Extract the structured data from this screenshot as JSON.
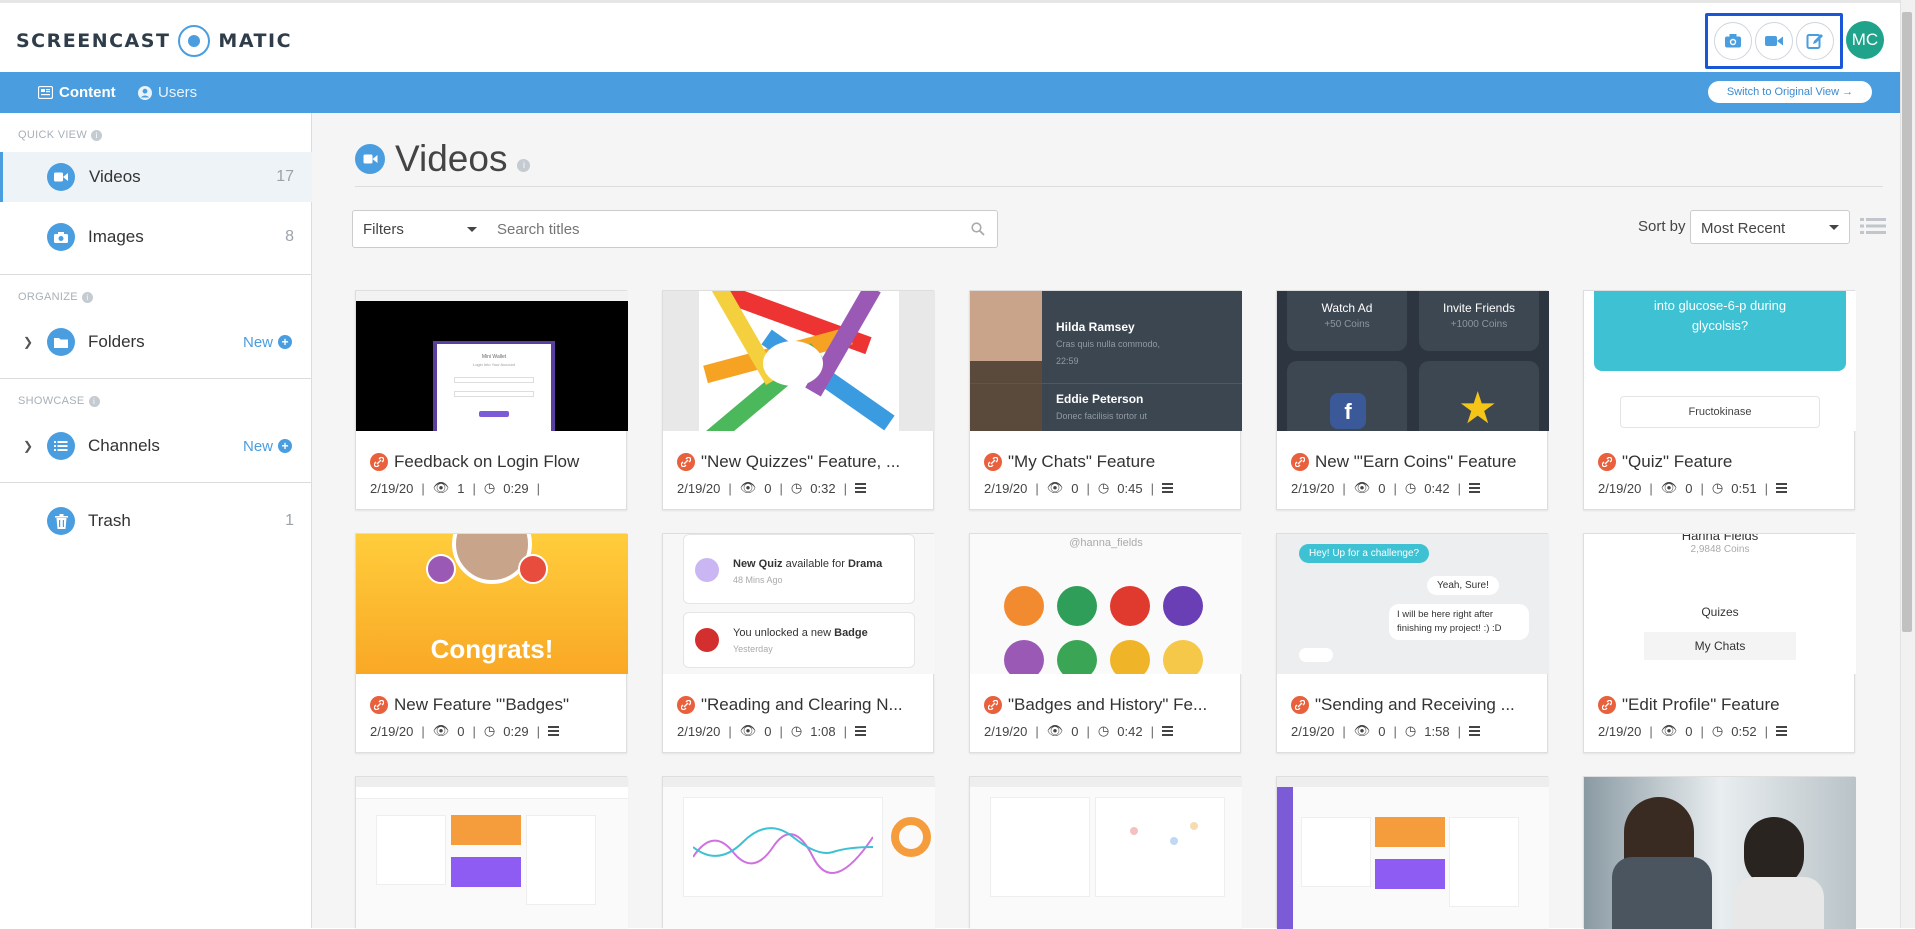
{
  "header": {
    "logo_left": "SCREENCAST",
    "logo_right": "MATIC",
    "avatar_initials": "MC",
    "record_buttons": [
      "camera-icon",
      "video-camera-icon",
      "edit-icon"
    ]
  },
  "nav": {
    "tabs": [
      {
        "label": "Content",
        "icon": "content-icon",
        "active": true
      },
      {
        "label": "Users",
        "icon": "user-icon",
        "active": false
      }
    ],
    "switch_label": "Switch to Original View →"
  },
  "sidebar": {
    "quick_view_label": "QUICK VIEW",
    "organize_label": "ORGANIZE",
    "showcase_label": "SHOWCASE",
    "videos": {
      "label": "Videos",
      "count": "17"
    },
    "images": {
      "label": "Images",
      "count": "8"
    },
    "folders": {
      "label": "Folders",
      "new_label": "New"
    },
    "channels": {
      "label": "Channels",
      "new_label": "New"
    },
    "trash": {
      "label": "Trash",
      "count": "1"
    }
  },
  "main": {
    "title": "Videos",
    "filters_label": "Filters",
    "search_placeholder": "Search titles",
    "sort_label": "Sort by",
    "sort_value": "Most Recent"
  },
  "videos": [
    {
      "title": "Feedback on Login Flow",
      "date": "2/19/20",
      "views": "1",
      "duration": "0:29",
      "thumb": "login"
    },
    {
      "title": "\"New Quizzes\" Feature, ...",
      "date": "2/19/20",
      "views": "0",
      "duration": "0:32",
      "thumb": "pencils"
    },
    {
      "title": "\"My Chats\" Feature",
      "date": "2/19/20",
      "views": "0",
      "duration": "0:45",
      "thumb": "chats"
    },
    {
      "title": "New \"'Earn Coins\" Feature",
      "date": "2/19/20",
      "views": "0",
      "duration": "0:42",
      "thumb": "coins"
    },
    {
      "title": "\"Quiz\" Feature",
      "date": "2/19/20",
      "views": "0",
      "duration": "0:51",
      "thumb": "quiz"
    },
    {
      "title": "New Feature \"'Badges\"",
      "date": "2/19/20",
      "views": "0",
      "duration": "0:29",
      "thumb": "congrats"
    },
    {
      "title": "\"Reading and Clearing N...",
      "date": "2/19/20",
      "views": "0",
      "duration": "1:08",
      "thumb": "notifications"
    },
    {
      "title": "\"Badges and History\" Fe...",
      "date": "2/19/20",
      "views": "0",
      "duration": "0:42",
      "thumb": "badges"
    },
    {
      "title": "\"Sending and Receiving ...",
      "date": "2/19/20",
      "views": "0",
      "duration": "1:58",
      "thumb": "messages"
    },
    {
      "title": "\"Edit Profile\" Feature",
      "date": "2/19/20",
      "views": "0",
      "duration": "0:52",
      "thumb": "profile"
    },
    {
      "title": "",
      "date": "",
      "views": "",
      "duration": "",
      "thumb": "dash1"
    },
    {
      "title": "",
      "date": "",
      "views": "",
      "duration": "",
      "thumb": "dash2"
    },
    {
      "title": "",
      "date": "",
      "views": "",
      "duration": "",
      "thumb": "dash3"
    },
    {
      "title": "",
      "date": "",
      "views": "",
      "duration": "",
      "thumb": "dash4"
    },
    {
      "title": "",
      "date": "",
      "views": "",
      "duration": "",
      "thumb": "office"
    }
  ],
  "thumb_text": {
    "login": {
      "heading": "Mini Wallet",
      "sub": "Login Into Your Account"
    },
    "chats": {
      "name1": "Hilda Ramsey",
      "msg1": "Cras quis nulla commodo,",
      "time1": "22:59",
      "name2": "Eddie Peterson",
      "msg2": "Donec facilisis tortor ut"
    },
    "coins": {
      "t1": "Watch Ad",
      "s1": "+50 Coins",
      "t2": "Invite Friends",
      "s2": "+1000 Coins"
    },
    "quiz": {
      "question": "into glucose-6-p during glycolsis?",
      "answer": "Fructokinase"
    },
    "congrats": {
      "text": "Congrats!"
    },
    "notifications": {
      "n1a": "New Quiz",
      "n1b": " available for ",
      "n1c": "Drama",
      "n1t": "48 Mins Ago",
      "n2a": "You unlocked a new ",
      "n2b": "Badge",
      "n2t": "Yesterday"
    },
    "badges": {
      "handle": "@hanna_fields"
    },
    "messages": {
      "m1": "Hey! Up for a challenge?",
      "m2": "Yeah, Sure!",
      "m3": "I will be here right after finishing my project! :) :D"
    },
    "profile": {
      "name": "Hanna Fields",
      "coins": "2,9848 Coins",
      "l1": "Quizes",
      "l2": "My Chats"
    }
  },
  "colors": {
    "accent": "#4a9ee0",
    "link": "#e8603c",
    "highlight": "#1a56d6"
  }
}
